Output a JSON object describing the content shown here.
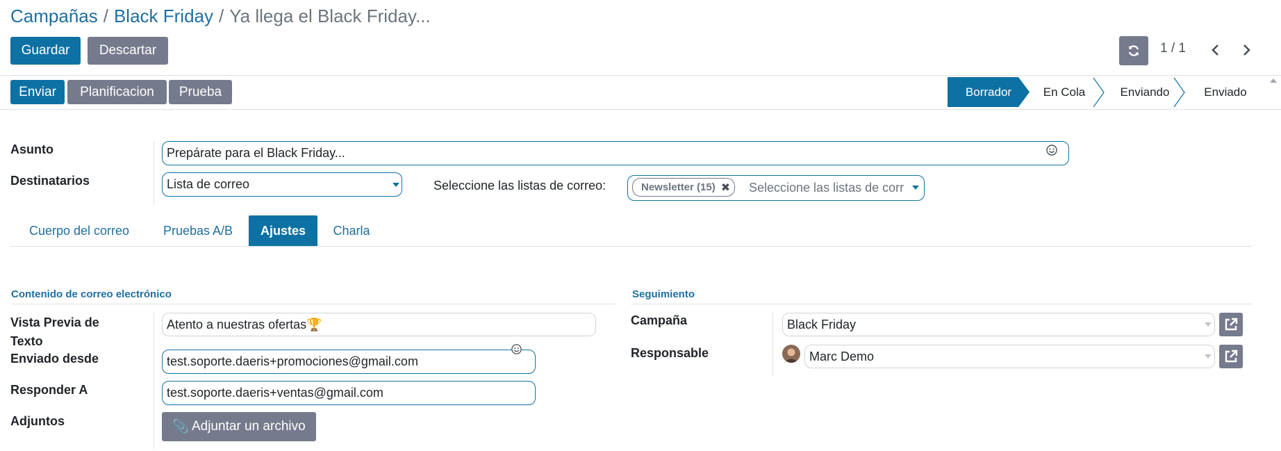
{
  "breadcrumb": {
    "items": [
      "Campañas",
      "Black Friday"
    ],
    "separator": "/",
    "current": "Ya llega el Black Friday..."
  },
  "actions": {
    "save": "Guardar",
    "discard": "Descartar"
  },
  "pager": {
    "value": "1 / 1",
    "refresh_icon": "refresh-icon",
    "prev_icon": "chevron-left-icon",
    "next_icon": "chevron-right-icon"
  },
  "buttons": {
    "send": "Enviar",
    "schedule": "Planificacion",
    "test": "Prueba"
  },
  "status": {
    "stages": [
      "Borrador",
      "En Cola",
      "Enviando",
      "Enviado"
    ],
    "active": "Borrador"
  },
  "form": {
    "subject": {
      "label": "Asunto",
      "value": "Prepárate para el Black Friday..."
    },
    "recipients": {
      "label": "Destinatarios",
      "value": "Lista de correo"
    },
    "mailing_lists": {
      "label": "Seleccione las listas de correo:",
      "tag": "Newsletter (15)",
      "placeholder": "Seleccione las listas de correo..."
    }
  },
  "tabs": [
    "Cuerpo del correo",
    "Pruebas A/B",
    "Ajustes",
    "Charla"
  ],
  "active_tab": "Ajustes",
  "email_content": {
    "title": "Contenido de correo electrónico",
    "preview_label": "Vista Previa de Texto",
    "preview_value": "Atento a nuestras ofertas",
    "preview_emoji": "🏆",
    "from_label": "Enviado desde",
    "from_value": "test.soporte.daeris+promociones@gmail.com",
    "reply_label": "Responder A",
    "reply_value": "test.soporte.daeris+ventas@gmail.com",
    "attachments_label": "Adjuntos",
    "attach_button": "Adjuntar un archivo"
  },
  "tracking": {
    "title": "Seguimiento",
    "campaign_label": "Campaña",
    "campaign_value": "Black Friday",
    "responsible_label": "Responsable",
    "responsible_value": "Marc Demo"
  },
  "colors": {
    "primary": "#0e71a3",
    "secondary": "#757a8c",
    "link": "#1f6f9f"
  }
}
